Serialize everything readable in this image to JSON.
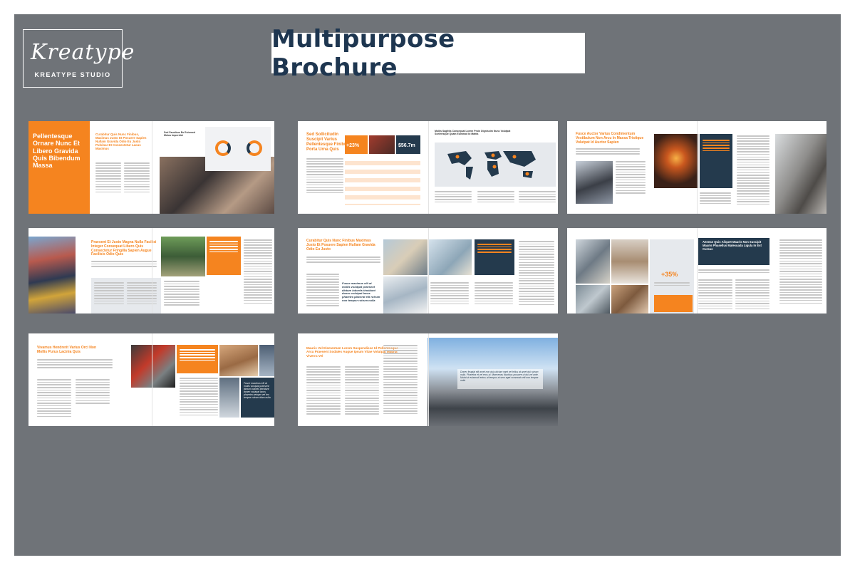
{
  "brand": {
    "logo_script": "Kreatype",
    "studio_name": "KREATYPE STUDIO"
  },
  "title": "Multipurpose Brochure",
  "spreads": {
    "s1": {
      "cover_heading": "Pellentesque Ornare Nunc Et Libero Gravida Quis Bibendum Massa",
      "heading": "Curabitur Quis Nunc Finibus, Maximus Justo Et Posuere Sapien Nullam Gravida Odio Eu Justo Pulvinar Et Consectetur Lacus Maximus",
      "stat_title": "Sed Faucibus Eu Euismod Metus Imperdiet"
    },
    "s2": {
      "heading": "Sed Sollicitudin Suscipit Varius Pellentesque Finibus Porta Urna Quis",
      "stat1": "+23%",
      "stat2": "$56.7m",
      "map_title": "Mollis Sagittis Consequat Lorem Proin Dignissim Nunc Volutpat Scelerisque Quam Euismod Id Mattis"
    },
    "s3": {
      "heading": "Fusce Auctor Varius Condimentum Vestibulum Non Arcu In Massa Tristique Volutpat Id Auctor Sapien"
    },
    "s4": {
      "heading": "Praesent Et Justo Magna Nulla Facilisi Integer Consequat Libero Quis Consectetur Fringilla Sapien Augue Facilisis Odio Quis"
    },
    "s5": {
      "heading": "Curabitur Quis Nunc Finibus Maximus Justo Et Posuere Sapien Nullam Gravida Odio Eu Justo",
      "quote": "Fusce maximus elit at mollis volutpat praesent dictum lobortis tincidunt donec volutpat lacus pharetra placerat elit rutrum non tempor rutrum nulla"
    },
    "s6": {
      "heading": "Aenean Quis Aliquet Mauris Non Suscipit Mauris Phasellus Malesuada Ligula In Est Cursus",
      "stat": "+35%"
    },
    "s7": {
      "heading": "Vivamus Hendrerit Varius Orci Non Mollis Purus Lacinia Quis",
      "quote": "Fusce maximus elit at mollis volutpat praesent dictum lobortis tincidunt donec volutpat lacus pharetra semper vel leo tempor rutrum diam nulla"
    },
    "s8": {
      "heading": "Mauris Vel Elementum Lorem Suspendisse Id Pellentesque Arcu Praesent Sodales Augue Ipsum Vitae Volutpat Magna Viverra Vel",
      "quote": "Donec feugiat elit amet non duis dictum eget vel tellus at amet dui rutrum nulla. Pharetra et vel eros ut. Maecenas faucibus posuere ut dui vel ante. Morbi ut euismod lectus ut tempus at sem eget commodo elit non tempor nulla"
    }
  },
  "colors": {
    "background": "#6f7378",
    "accent": "#f5841f",
    "navy": "#243a4d",
    "title_text": "#1e3650"
  }
}
